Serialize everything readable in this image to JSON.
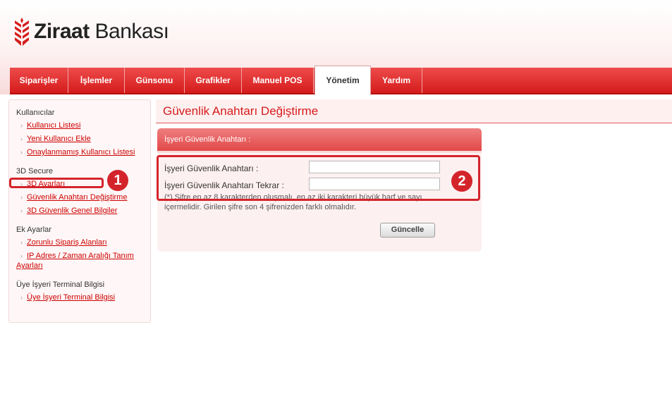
{
  "brand": {
    "name_bold": "Ziraat",
    "name_regular": "Bankası",
    "logo_icon": "wheat-logo-icon",
    "accent": "#d51c1c"
  },
  "nav": {
    "items": [
      {
        "label": "Siparişler"
      },
      {
        "label": "İşlemler"
      },
      {
        "label": "Günsonu"
      },
      {
        "label": "Grafikler"
      },
      {
        "label": "Manuel POS"
      },
      {
        "label": "Yönetim"
      },
      {
        "label": "Yardım"
      }
    ],
    "active": "Yönetim"
  },
  "sidebar": {
    "sections": [
      {
        "heading": "Kullanıcılar",
        "links": [
          "Kullanıcı Listesi",
          "Yeni Kullanıcı Ekle",
          "Onaylanmamış Kullanıcı Listesi"
        ]
      },
      {
        "heading": "3D Secure",
        "links": [
          "3D Ayarları",
          "Güvenlik Anahtarı Değiştirme",
          "3D Güvenlik Genel Bilgiler"
        ]
      },
      {
        "heading": "Ek Ayarlar",
        "links": [
          "Zorunlu Sipariş Alanları",
          "IP Adres / Zaman Aralığı Tanım",
          "Ayarları"
        ]
      },
      {
        "heading": "Üye İşyeri Terminal Bilgisi",
        "links": [
          "Üye İşyeri Terminal Bilgisi"
        ]
      }
    ]
  },
  "page": {
    "title": "Güvenlik Anahtarı Değiştirme"
  },
  "panel": {
    "header": "İşyeri Güvenlik Anahtarı :",
    "fields": [
      {
        "label": "İşyeri Güvenlik Anahtarı :",
        "value": ""
      },
      {
        "label": "İşyeri Güvenlik Anahtarı Tekrar :",
        "value": ""
      }
    ],
    "note_line1": "(*) Şifre en az 8 karakterden oluşmalı, en az iki karakteri büyük harf ve sayı",
    "note_line2": "içermelidir. Girilen şifre son 4 şifrenizden farklı olmalıdır.",
    "button_label": "Güncelle"
  },
  "annotations": {
    "marker1": "1",
    "marker2": "2",
    "color": "#d4242b"
  }
}
